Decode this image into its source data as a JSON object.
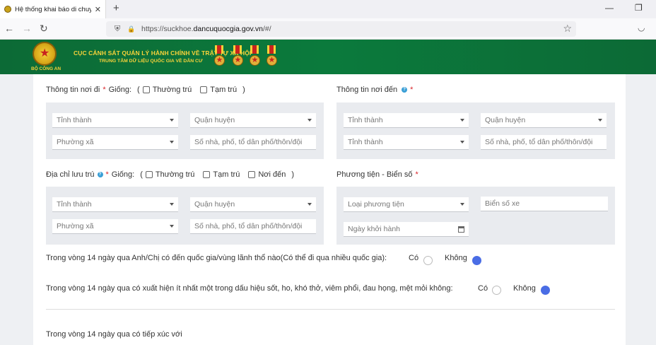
{
  "browser": {
    "tab_title": "Hệ thống khai báo di chuyển nội",
    "tab_close": "✕",
    "new_tab": "+",
    "url_prefix": "https://suckhoe.",
    "url_domain": "dancuquocgia.gov.vn",
    "url_suffix": "/#/",
    "minimize": "—",
    "restore": "❐",
    "back": "←",
    "forward": "→",
    "reload": "↻",
    "shield": "⛨",
    "lock": "🔒",
    "star": "☆",
    "pocket": "◡"
  },
  "banner": {
    "line1": "CỤC CẢNH SÁT QUẢN LÝ HÀNH CHÍNH VỀ TRẬT TỰ XÃ HỘI",
    "line2": "TRUNG TÂM DỮ LIỆU QUỐC GIA VỀ DÂN CƯ",
    "logo_text": "BỘ CÔNG AN",
    "color": "#0b7a3c",
    "accent": "#f7d23a"
  },
  "form": {
    "origin": {
      "label": "Thông tin nơi đi",
      "required": "*",
      "same_as": "Giống:",
      "open_paren": "(",
      "close_paren": ")",
      "opt1": "Thường trú",
      "opt2": "Tạm trú",
      "province": "Tỉnh thành",
      "district": "Quận huyện",
      "ward": "Phường xã",
      "street": "Số nhà, phố, tổ dân phố/thôn/đội"
    },
    "destination": {
      "label": "Thông tin nơi đến",
      "required": "*",
      "province": "Tỉnh thành",
      "district": "Quận huyện",
      "province2": "Tỉnh thành",
      "street": "Số nhà, phố, tổ dân phố/thôn/đội"
    },
    "stay": {
      "label": "Địa chỉ lưu trú",
      "required": "*",
      "same_as": "Giống:",
      "open_paren": "(",
      "close_paren": ")",
      "opt1": "Thường trú",
      "opt2": "Tạm trú",
      "opt3": "Nơi đến",
      "province": "Tỉnh thành",
      "district": "Quận huyện",
      "ward": "Phường xã",
      "street": "Số nhà, phố, tổ dân phố/thôn/đội"
    },
    "vehicle": {
      "label": "Phương tiện - Biển số",
      "required": "*",
      "type": "Loại phương tiện",
      "plate": "Biển số xe",
      "date": "Ngày khởi hành"
    },
    "q1": {
      "text": "Trong vòng 14 ngày qua Anh/Chị có đến quốc gia/vùng lãnh thổ nào(Có thể đi qua nhiều quốc gia):",
      "yes": "Có",
      "no": "Không",
      "selected": "Không"
    },
    "q2": {
      "text": "Trong vòng 14 ngày qua có xuất hiện ít nhất một trong dấu hiệu sốt, ho, khó thở, viêm phổi, đau họng, mệt mỏi không:",
      "yes": "Có",
      "no": "Không",
      "selected": "Không"
    },
    "q3": {
      "text": "Trong vòng 14 ngày qua có tiếp xúc với"
    },
    "help_glyph": "?",
    "radio_color": "#4a6de5"
  }
}
